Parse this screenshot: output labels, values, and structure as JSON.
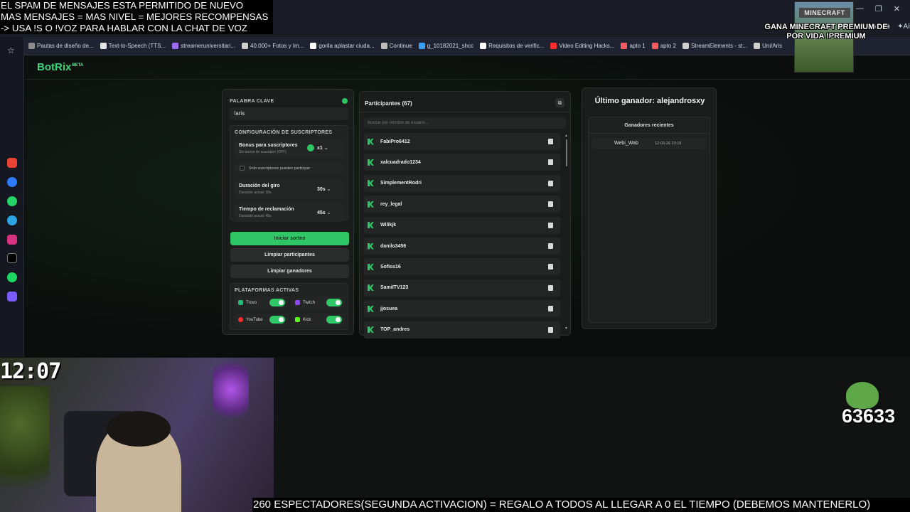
{
  "overlay": {
    "line1": "EL SPAM DE MENSAJES ESTA PERMITIDO DE NUEVO",
    "line2": "MAS MENSAJES = MAS NIVEL = MEJORES RECOMPENSAS",
    "line3": "-> USA !S O !VOZ PARA HABLAR CON LA CHAT DE VOZ"
  },
  "promo": {
    "logo": "MINECRAFT",
    "text": "GANA MINECRAFT PREMIUM DE POR VIDA !PREMIUM"
  },
  "browser": {
    "ai_label": "AI",
    "bookmarks": [
      {
        "label": "Pautas de diseño de...",
        "color": "#8c8c8c"
      },
      {
        "label": "Text-to-Speech (TTS...",
        "color": "#e6e6e6"
      },
      {
        "label": "streameruniversitari...",
        "color": "#9b6cf0"
      },
      {
        "label": "40.000+ Fotos y Im...",
        "color": "#cfcfcf"
      },
      {
        "label": "gorila aplastar ciuda...",
        "color": "#ffffff"
      },
      {
        "label": "Continue",
        "color": "#bdbdbd"
      },
      {
        "label": "g_10182021_shcc",
        "color": "#3aa0ff"
      },
      {
        "label": "Requisitos de verific...",
        "color": "#ffffff"
      },
      {
        "label": "Video Editing Hacks...",
        "color": "#ff2d2d"
      },
      {
        "label": "apto 1",
        "color": "#ff5a5f"
      },
      {
        "label": "apto 2",
        "color": "#ff5a5f"
      },
      {
        "label": "StreamElements - st...",
        "color": "#cfcfcf"
      },
      {
        "label": "Uni/Aris",
        "color": "#cfcfcf"
      }
    ]
  },
  "brand": {
    "name": "BotRix",
    "badge": "BETA"
  },
  "settings": {
    "keyword_label": "PALABRA CLAVE",
    "keyword_value": "!aris",
    "subs_config_label": "CONFIGURACIÓN DE SUSCRIPTORES",
    "bonus_title": "Bonus para suscriptores",
    "bonus_sub": "Sin bonus de suscriptor (OFF)",
    "bonus_value": "x1",
    "subs_only_label": "Solo suscriptores pueden participar",
    "spin_title": "Duración del giro",
    "spin_sub": "Duración actual: 30s",
    "spin_value": "30s",
    "claim_title": "Tiempo de reclamación",
    "claim_sub": "Duración actual: 45s",
    "claim_value": "45s",
    "start_button": "Iniciar sorteo",
    "clear_participants": "Limpiar participantes",
    "clear_winners": "Limpiar ganadores",
    "platforms_label": "PLATAFORMAS ACTIVAS",
    "platforms": [
      {
        "name": "Trovo",
        "color": "#1fbf7a"
      },
      {
        "name": "Twitch",
        "color": "#9146ff"
      },
      {
        "name": "YouTube",
        "color": "#ff2b2b"
      },
      {
        "name": "Kick",
        "color": "#53fc18"
      }
    ]
  },
  "participants": {
    "title": "Participantes (67)",
    "search_placeholder": "Buscar por nombre de usuario...",
    "list": [
      "FabiPro6412",
      "xalcuadrado1234",
      "SimplementRodri",
      "rey_legal",
      "Wilikjk",
      "danilo3456",
      "Sofiss16",
      "SamiITV123",
      "jjosuea",
      "TOP_andres"
    ]
  },
  "winner": {
    "title": "Último ganador: alejandrosxy",
    "recent_label": "Ganadores recientes",
    "recent": [
      {
        "name": "Webi_Wab",
        "date": "12-03-26 23:19"
      }
    ]
  },
  "stream": {
    "clock": "12:07",
    "counter": "63633",
    "ticker": "260 ESPECTADORES(SEGUNDA ACTIVACION) = REGALO A TODOS AL LLEGAR A 0 EL TIEMPO (DEBEMOS MANTENERLO)"
  }
}
